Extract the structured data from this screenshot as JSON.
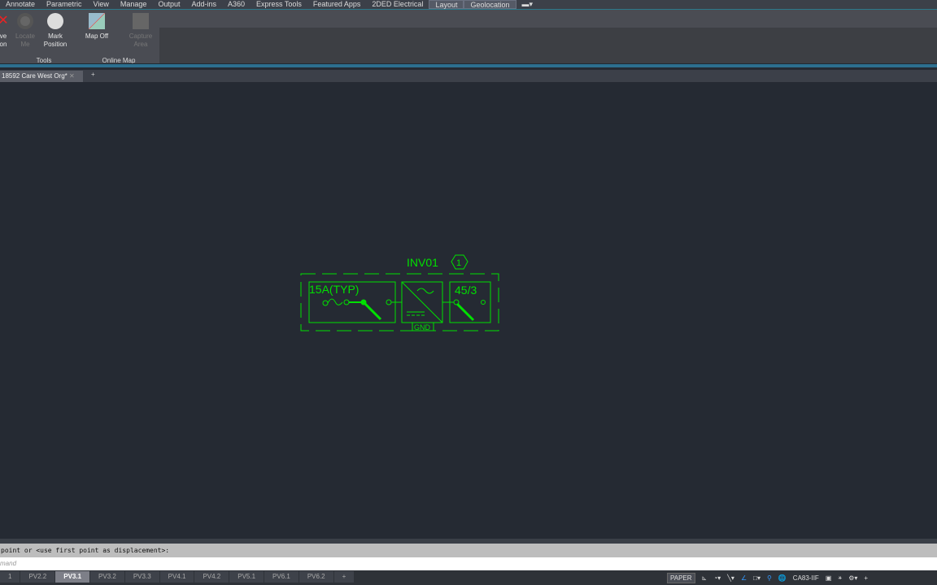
{
  "ribbon_tabs": [
    "Annotate",
    "Parametric",
    "View",
    "Manage",
    "Output",
    "Add-ins",
    "A360",
    "Express Tools",
    "Featured Apps",
    "2DED Electrical",
    "Layout",
    "Geolocation"
  ],
  "active_tab": "Geolocation",
  "buttons": {
    "remove": "ve\non",
    "locate": "Locate\nMe",
    "mark": "Mark\nPosition",
    "map_off": "Map Off",
    "capture": "Capture\nArea"
  },
  "panels": {
    "tools": "Tools",
    "online_map": "Online Map"
  },
  "file_tab": "18592 Care West Org*",
  "drawing": {
    "tag": "INV01",
    "bubble": "1",
    "breaker": "15A(TYP)",
    "disconnect": "45/3",
    "gnd": "GND"
  },
  "command": {
    "history": "point or <use first point as displacement>:",
    "placeholder": "mand"
  },
  "layouts": [
    "1",
    "PV2.2",
    "PV3.1",
    "PV3.2",
    "PV3.3",
    "PV4.1",
    "PV4.2",
    "PV5.1",
    "PV6.1",
    "PV6.2",
    "+"
  ],
  "active_layout": "PV3.1",
  "status": {
    "paper": "PAPER",
    "coord": "CA83-IIF"
  },
  "colors": {
    "drawing": "#00e000",
    "canvas": "#252a33"
  }
}
